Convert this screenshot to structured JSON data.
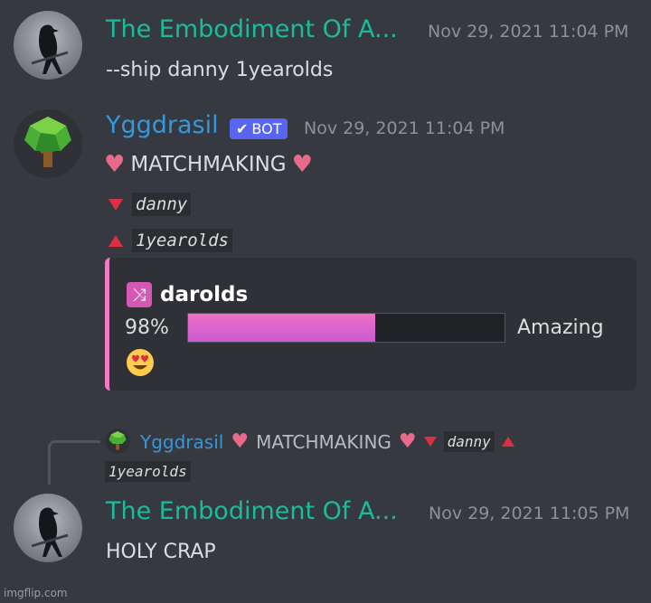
{
  "messages": [
    {
      "author": "The Embodiment Of A...",
      "timestamp": "Nov 29, 2021 11:04 PM",
      "content": "--ship danny 1yearolds"
    },
    {
      "author": "Yggdrasil",
      "bot_badge": "BOT",
      "timestamp": "Nov 29, 2021 11:04 PM",
      "title": "MATCHMAKING",
      "down_name": "danny",
      "up_name": "1yearolds",
      "embed": {
        "ship_name": "darolds",
        "percent_text": "98%",
        "progress": 0.98,
        "bar_fill_fraction": 0.59,
        "rating": "Amazing",
        "emoji": "heart-eyes"
      }
    },
    {
      "reply_preview": {
        "author": "Yggdrasil",
        "title": "MATCHMAKING",
        "down_name": "danny",
        "up_name": "1yearolds"
      },
      "author": "The Embodiment Of A...",
      "timestamp": "Nov 29, 2021 11:05 PM",
      "content": "HOLY CRAP"
    }
  ],
  "watermark": "imgflip.com",
  "colors": {
    "background": "#36393f",
    "user_name": "#1abc9c",
    "bot_name": "#3498db",
    "bot_badge": "#5865f2",
    "embed_accent": "#ee7ac3",
    "heart": "#e86a8a",
    "triangle": "#dd2e44"
  }
}
